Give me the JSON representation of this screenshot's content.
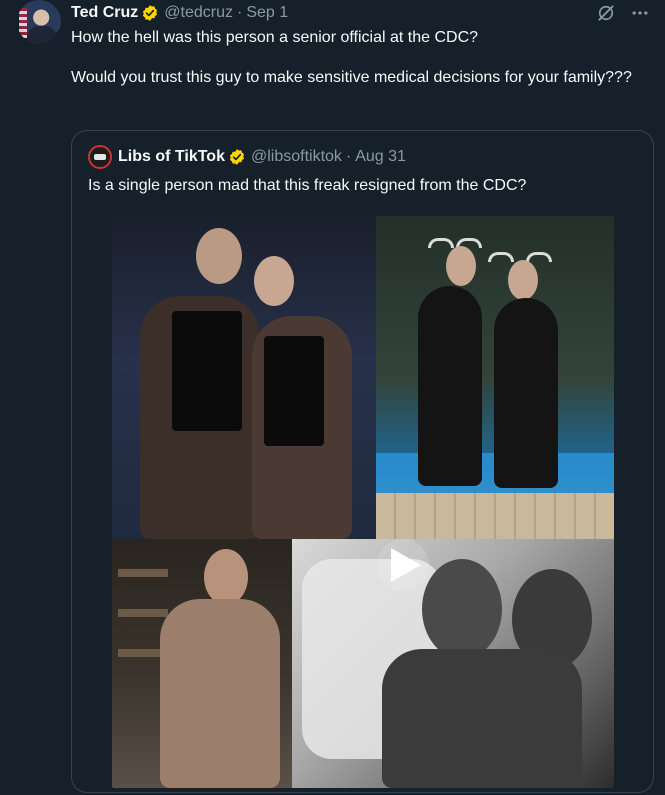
{
  "tweet": {
    "author_name": "Ted Cruz",
    "author_handle": "@tedcruz",
    "separator": "·",
    "date": "Sep 1",
    "text_line1": "How the hell was this person a senior official at the CDC?",
    "text_line2": "Would you trust this guy to make sensitive medical decisions for your family???"
  },
  "quote": {
    "author_name": "Libs of TikTok",
    "author_handle": "@libsoftiktok",
    "separator": "·",
    "date": "Aug 31",
    "text": "Is a single person mad that this freak resigned from the CDC?"
  },
  "icons": {
    "verified": "verified-badge-icon",
    "grok": "grok-icon",
    "more": "more-icon",
    "play": "play-icon"
  },
  "colors": {
    "background": "#15202b",
    "verified_badge": "#ffd400",
    "secondary_text": "#8b98a5",
    "border": "#38444d"
  }
}
